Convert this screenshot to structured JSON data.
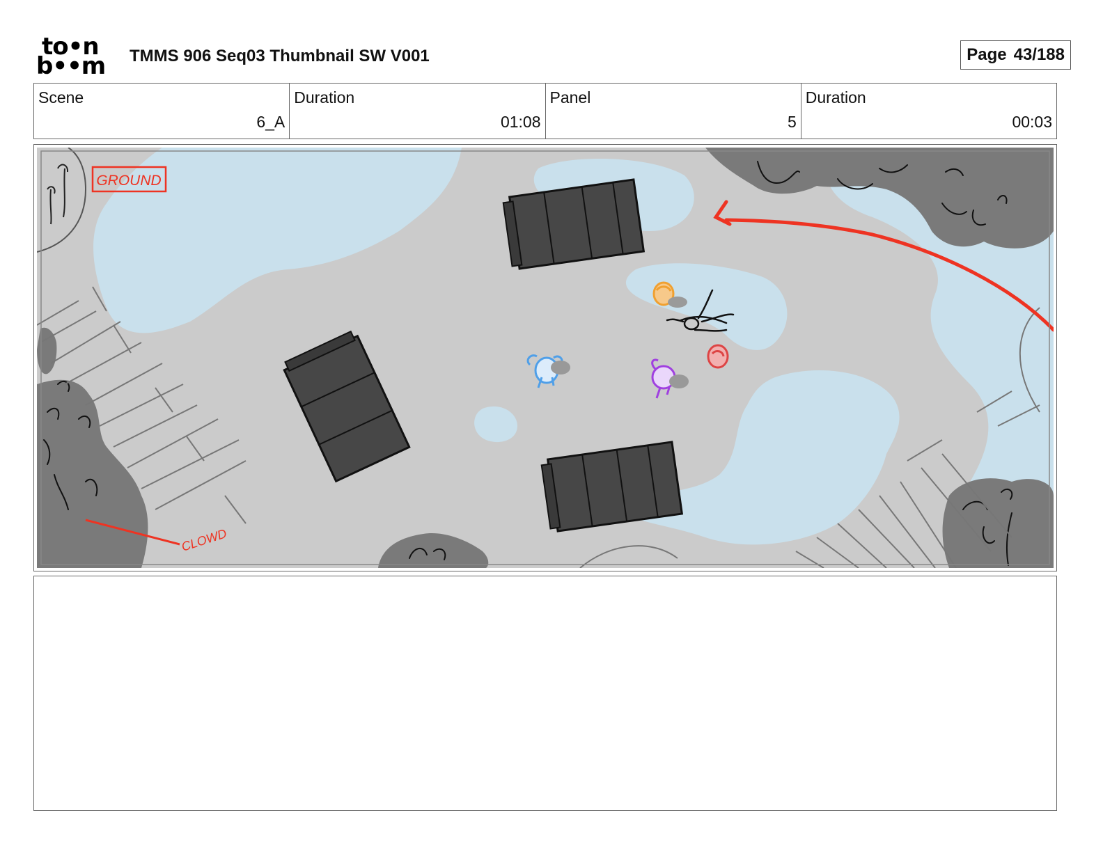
{
  "header": {
    "logo_top": "to•n",
    "logo_bottom": "b••m",
    "title": "TMMS 906 Seq03 Thumbnail SW V001",
    "page_label": "Page",
    "page_value": "43/188"
  },
  "info": {
    "scene_label": "Scene",
    "scene_value": "6_A",
    "scene_duration_label": "Duration",
    "scene_duration_value": "01:08",
    "panel_label": "Panel",
    "panel_value": "5",
    "panel_duration_label": "Duration",
    "panel_duration_value": "00:03"
  },
  "panel": {
    "ground_label": "GROUND",
    "crowd_label": "CLOWD",
    "colors": {
      "ground": "#cbcbcb",
      "water": "#c9e0ec",
      "trees": "#7a7a7a",
      "trucks": "#474747",
      "annotation_red": "#ee3322",
      "char_orange": "#f0a030",
      "char_red": "#dd4444",
      "char_blue": "#4f9fe8",
      "char_purple": "#a040e0"
    }
  },
  "notes": {
    "text": ""
  }
}
